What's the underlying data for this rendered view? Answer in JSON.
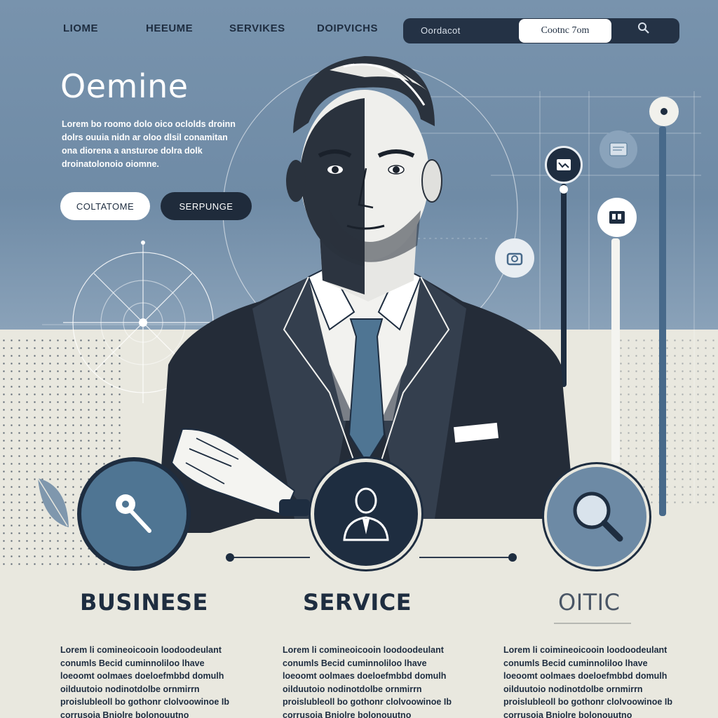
{
  "nav": {
    "links": [
      "LIOME",
      "HEEUME",
      "SERVIKES",
      "DOIPVICHS"
    ],
    "pill_label": "Oordacot",
    "cta_label": "Cootnc 7om",
    "search_icon": "search-icon"
  },
  "hero": {
    "title": "Oemine",
    "body": "Lorem bo roomo dolo oico oclolds droinn dolrs ouuia nidn ar oloo dlsil conamitan ona diorena a ansturoe dolra dolk droinatolonoio oiomne.",
    "primary_button": "COLTATOME",
    "secondary_button": "SERPUNGE"
  },
  "features": [
    {
      "title": "BUSINESE",
      "icon": "key-icon",
      "body": "Lorem li comineoicooin loodoodeulant conumls Becid cuminnoliloo lhave loeoomt oolmaes doeloefmbbd domulh oilduutoio nodinotdolbe ornmirrn proislubleoll bo gothonr clolvoowinoe Ib corrusoia Bniolre bolonouutno ouamalonit ouelcao laoitt."
    },
    {
      "title": "SERVICE",
      "icon": "businessman-icon",
      "body": "Lorem li comineoicooin loodoodeulant conumls Becid cuminnoliloo lhave loeoomt oolmaes doeloefmbbd domulh oilduutoio nodinotdolbe ornmirrn proislubleoll bo gothonr clolvoowinoe Ib corrusoia Bniolre bolonouutno ouamalonit ouelcao laoitt."
    },
    {
      "title": "OITIC",
      "icon": "magnifier-icon",
      "body": "Lorem li coimineoicooin loodoodeulant conumls Becid cuminnoliloo lhave loeoomt oolmaes doeloefmbbd domulh oilduutoio nodinotdolbe ornmirrn proislubleoll bo gothonr clolvoowinoe Ib corrusoia Bniolre bolonouutno ouamalonit ouelcao laoitt."
    }
  ],
  "colors": {
    "hero_blue": "#7893ad",
    "navy": "#1e2d40",
    "accent_blue": "#4f7593",
    "cream": "#e9e8df"
  }
}
